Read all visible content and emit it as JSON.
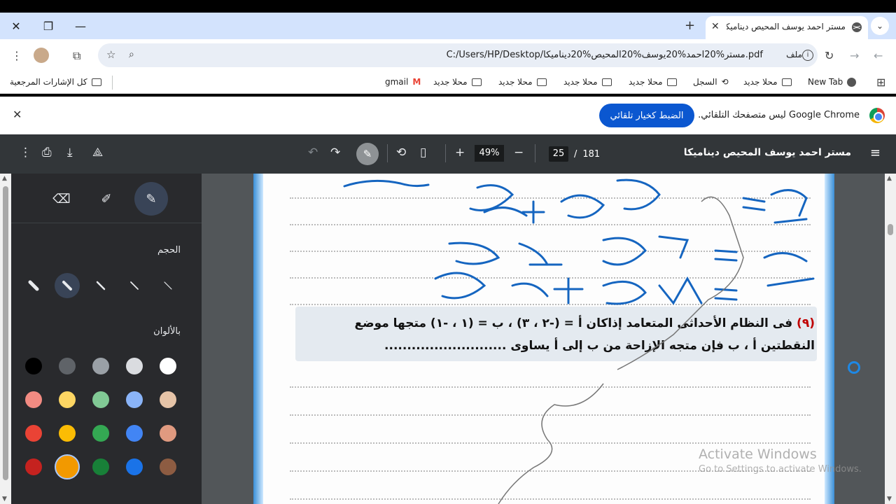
{
  "browser": {
    "tab_title": "مستر احمد يوسف المحيص ديناميكا",
    "url": "C:/Users/HP/Desktop/مستر%20احمد%20يوسف%20المحيص%20ديناميكا.pdf",
    "file_label": "ملف"
  },
  "bookmarks": {
    "items": [
      "New Tab",
      "محلا جديد",
      "السجل",
      "محلا جديد",
      "محلا جديد",
      "محلا جديد",
      "محلا جديد",
      "gmail"
    ],
    "all_bookmarks": "كل الإشارات المرجعية"
  },
  "infobar": {
    "message": "Google Chrome ليس متصفحك التلقائي.",
    "button": "الضبط كخيار تلقائي"
  },
  "pdf": {
    "title": "مستر احمد يوسف المحيص ديناميكا",
    "current_page": "25",
    "total_pages": "181",
    "zoom": "49%",
    "separator": "/"
  },
  "panel": {
    "size_label": "الحجم",
    "colors_label": "بالألوان",
    "colors": [
      "#ffffff",
      "#dadce0",
      "#9aa0a6",
      "#5f6368",
      "#000000",
      "#e6c4a8",
      "#8ab4f8",
      "#81c995",
      "#fdd663",
      "#f28b82",
      "#e09a80",
      "#4285f4",
      "#34a853",
      "#fbbc04",
      "#ea4335",
      "#8d5c42",
      "#1a73e8",
      "#188038",
      "#f29900",
      "#c5221f"
    ]
  },
  "document": {
    "question_number": "(٩)",
    "line1": "فى النظام الأحداثى المتعامد إذاكان  أ = (-٢ ، ٣) ، ب = (١ ، -١) متجها موضع",
    "line2": "النقطتين  أ ، ب  فإن متجه الإزاحة من ب إلى أ يساوى ..........................."
  },
  "watermark": {
    "line1": "Activate Windows",
    "line2": "Go to Settings to activate Windows."
  }
}
